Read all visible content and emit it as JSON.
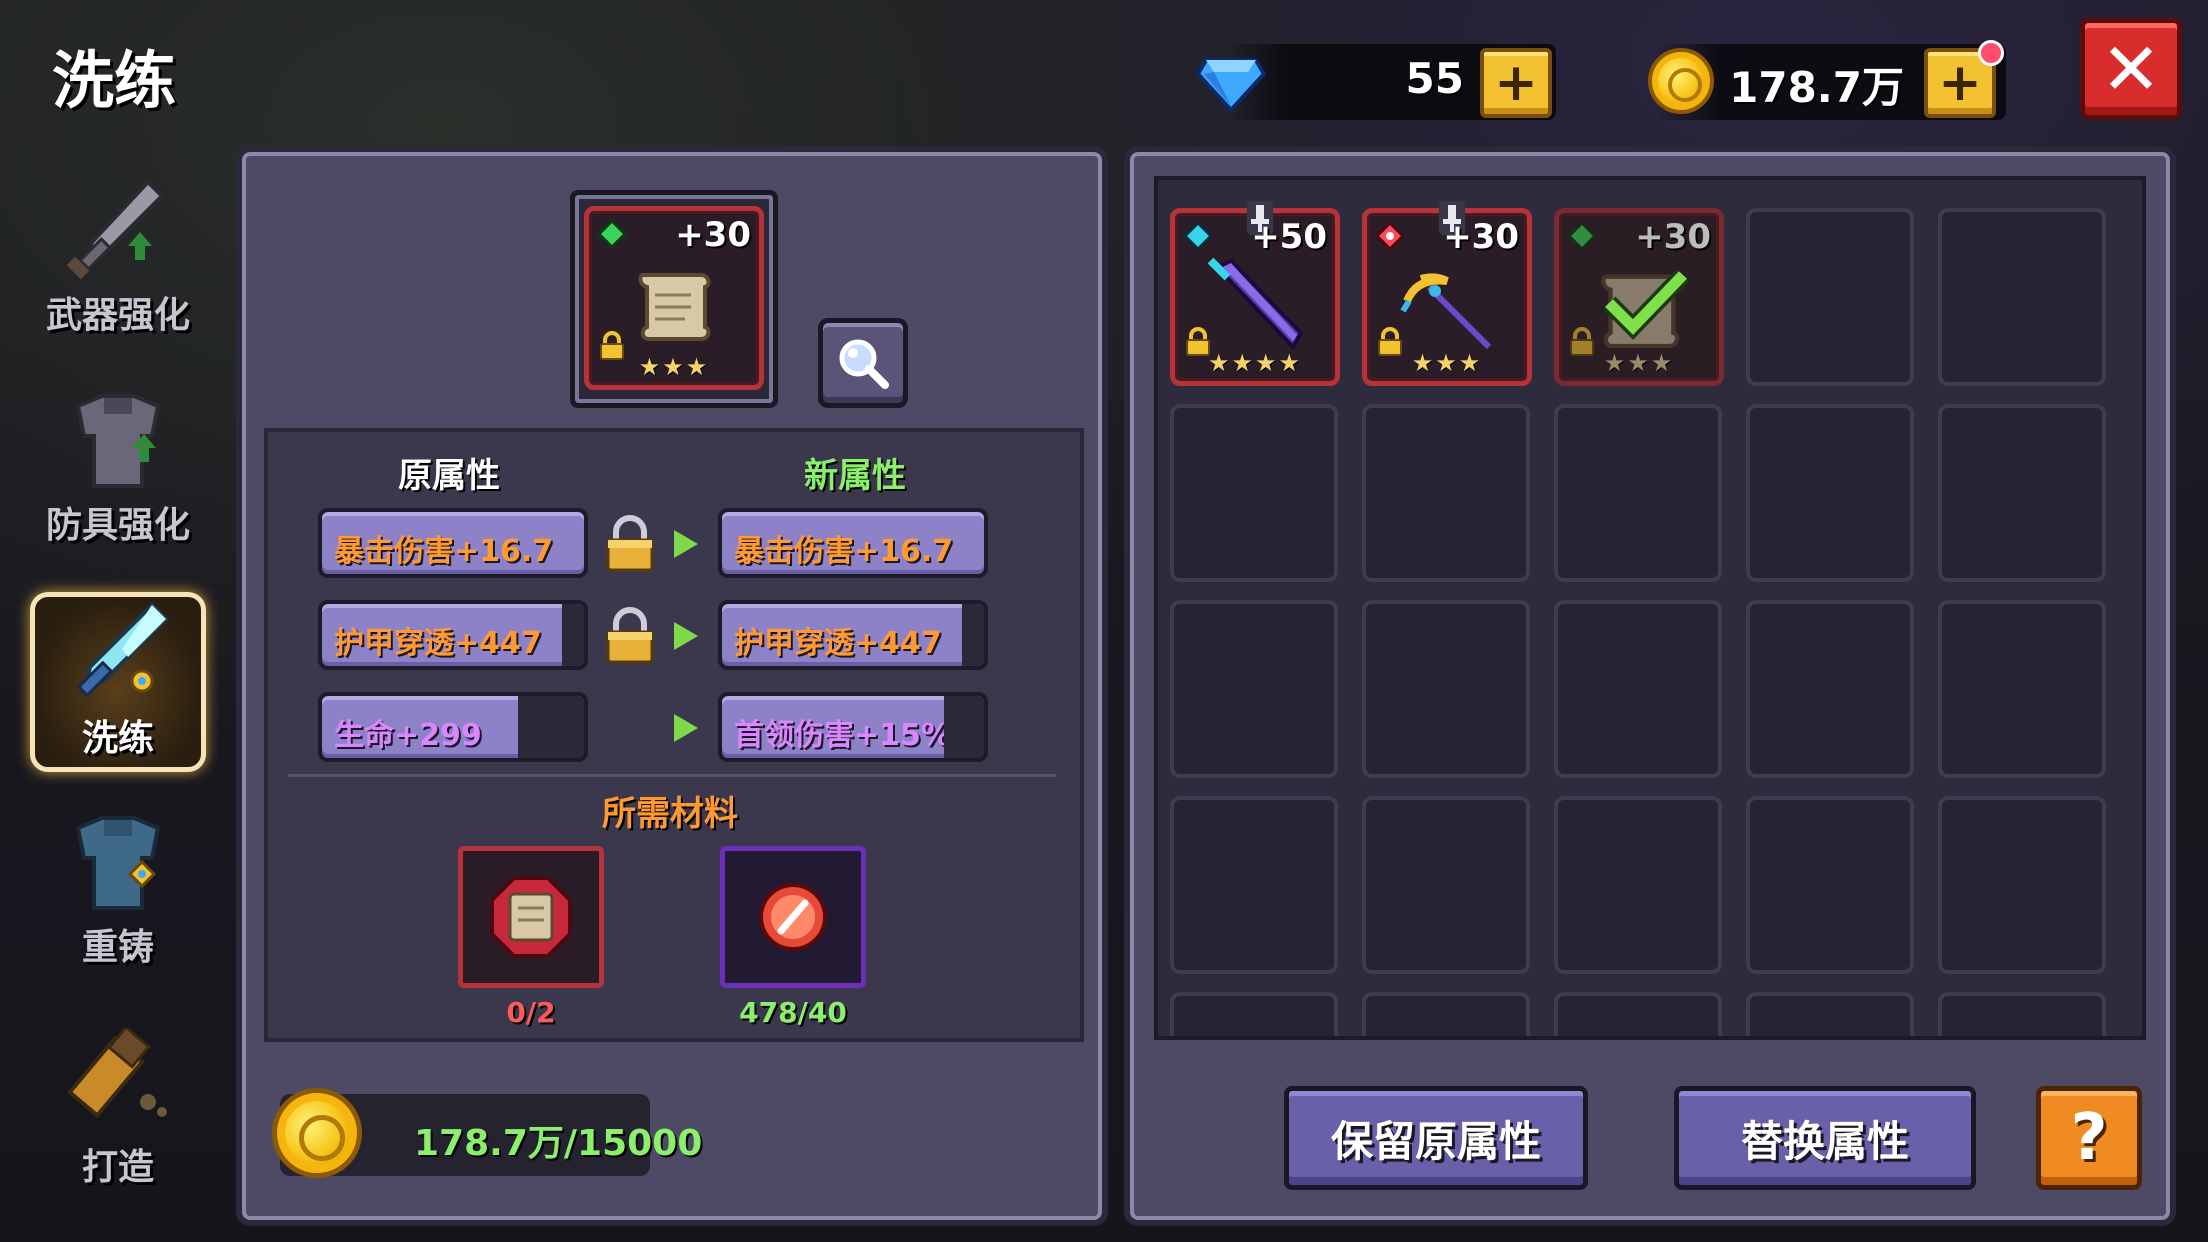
{
  "title": "洗练",
  "currency": {
    "gems": "55",
    "gold": "178.7万"
  },
  "sidebar": {
    "items": [
      {
        "label": "武器强化",
        "icon": "sword-upgrade-icon"
      },
      {
        "label": "防具强化",
        "icon": "armor-upgrade-icon"
      },
      {
        "label": "洗练",
        "icon": "reforge-sword-icon",
        "active": true
      },
      {
        "label": "重铸",
        "icon": "recast-armor-icon"
      },
      {
        "label": "打造",
        "icon": "forge-hammer-icon"
      }
    ]
  },
  "main_item": {
    "level": "+30",
    "stars": "★★★",
    "icon": "scroll-icon"
  },
  "attributes": {
    "original_header": "原属性",
    "new_header": "新属性",
    "rows": [
      {
        "old": "暴击伤害+16.7",
        "new": "暴击伤害+16.7",
        "locked": true
      },
      {
        "old": "护甲穿透+447",
        "new": "护甲穿透+447",
        "locked": true
      },
      {
        "old": "生命+299",
        "new": "首领伤害+15%",
        "locked": false
      }
    ]
  },
  "materials": {
    "title": "所需材料",
    "items": [
      {
        "icon": "scroll-material-icon",
        "count": "0/2"
      },
      {
        "icon": "reforge-stone-icon",
        "count": "478/40"
      }
    ]
  },
  "cost": {
    "text": "178.7万/15000"
  },
  "inventory": {
    "items": [
      {
        "level": "+50",
        "stars": "★★★★",
        "icon": "dark-sword-icon"
      },
      {
        "level": "+30",
        "stars": "★★★",
        "icon": "golden-spear-icon"
      },
      {
        "level": "+30",
        "stars": "★★★",
        "icon": "scroll-selected-icon",
        "selected": true
      }
    ]
  },
  "buttons": {
    "keep": "保留原属性",
    "replace": "替换属性",
    "help": "?",
    "close": "✕",
    "plus": "+"
  },
  "colors": {
    "orange_attr": "#ff9a33",
    "purple_attr": "#d986ff",
    "green": "#8aef6a",
    "red": "#ff5a5a",
    "panel": "#4e4a66"
  }
}
